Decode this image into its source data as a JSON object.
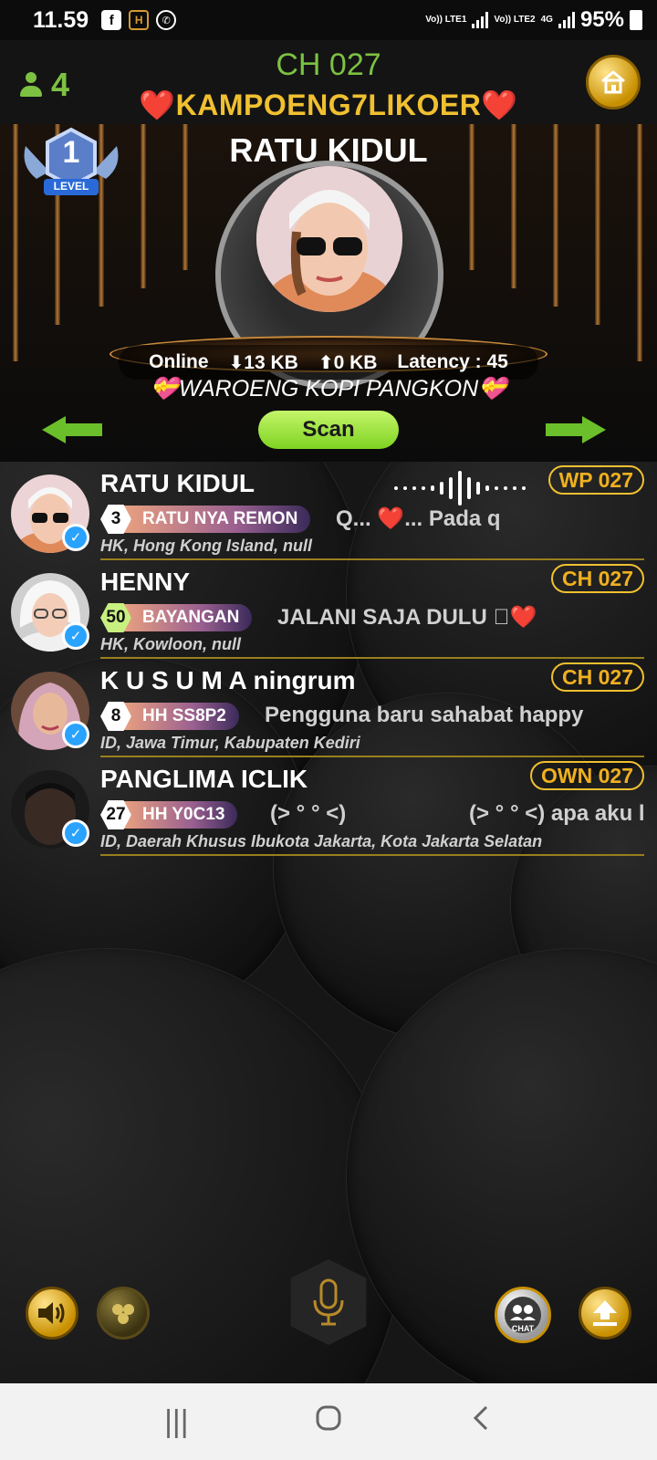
{
  "statusbar": {
    "time": "11.59",
    "sim1": "Vo)) LTE1",
    "sim2": "Vo)) LTE2",
    "net": "4G",
    "battery": "95%"
  },
  "header": {
    "user_count": "4",
    "channel": "CH 027",
    "room_name": "❤️KAMPOENG7LIKOER❤️"
  },
  "stage": {
    "level_number": "1",
    "level_label": "LEVEL",
    "host_name": "RATU KIDUL",
    "online_label": "Online",
    "download": "13 KB",
    "upload": "0 KB",
    "latency_label": "Latency :",
    "latency_value": "45",
    "motto": "💝WAROENG KOPI PANGKON💝",
    "scan_label": "Scan"
  },
  "members": [
    {
      "name": "RATU KIDUL",
      "tag": "WP 027",
      "level": "3",
      "title": "RATU NYA REMON",
      "status": "Q... ❤️... Pada q",
      "location": "HK, Hong Kong Island, null",
      "speaking": true
    },
    {
      "name": "HENNY",
      "tag": "CH 027",
      "level": "50",
      "title": "BAYANGAN",
      "status": "JALANI SAJA DULU 󾌧❤️",
      "location": "HK, Kowloon, null",
      "speaking": false
    },
    {
      "name": "K U S U M A ningrum",
      "tag": "CH 027",
      "level": "8",
      "title": "HH  SS8P2",
      "status": "Pengguna baru sahabat happy",
      "location": "ID, Jawa Timur, Kabupaten Kediri",
      "speaking": false
    },
    {
      "name": "PANGLIMA ICLIK",
      "tag": "OWN 027",
      "level": "27",
      "title": "HH  Y0C13",
      "status": "(> ° ° <)",
      "status2": "(> ° ° <) apa aku l",
      "location": "ID, Daerah Khusus Ibukota Jakarta, Kota Jakarta Selatan",
      "speaking": false
    }
  ],
  "bottom": {
    "chat_label": "CHAT"
  },
  "colors": {
    "accent_green": "#7dc142",
    "gold": "#f0c030",
    "verified_blue": "#2aa3ff"
  },
  "icons": [
    "person-icon",
    "home-icon",
    "arrow-left-icon",
    "arrow-right-icon",
    "speaker-icon",
    "effect-icon",
    "mic-icon",
    "chat-icon",
    "upload-icon",
    "recents-icon",
    "home-circle-icon",
    "back-icon"
  ]
}
